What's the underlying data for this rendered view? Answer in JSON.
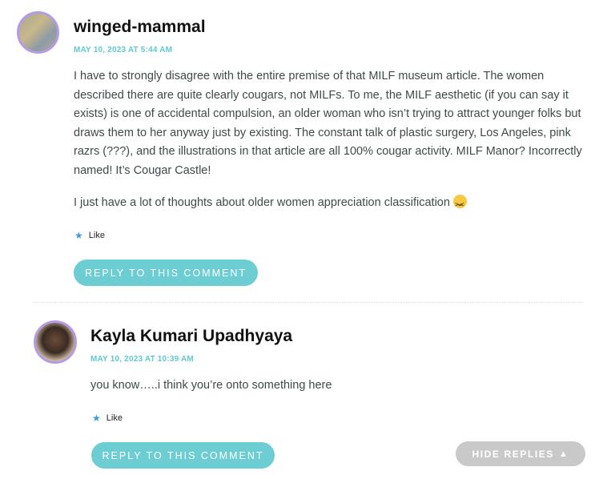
{
  "comments": [
    {
      "author": "winged-mammal",
      "date": "MAY 10, 2023 AT 5:44 AM",
      "paragraphs": [
        "I have to strongly disagree with the entire premise of that MILF museum article. The women described there are quite clearly cougars, not MILFs. To me, the MILF aesthetic (if you can say it exists) is one of accidental compulsion, an older woman who isn’t trying to attract younger folks but draws them to her anyway just by existing. The constant talk of plastic surgery, Los Angeles, pink razrs (???), and the illustrations in that article are all 100% cougar activity. MILF Manor? Incorrectly named! It’s Cougar Castle!",
        "I just have a lot of thoughts about older women appreciation classification"
      ],
      "like_label": "Like",
      "reply_label": "REPLY TO THIS COMMENT"
    },
    {
      "author": "Kayla Kumari Upadhyaya",
      "date": "MAY 10, 2023 AT 10:39 AM",
      "paragraphs": [
        "you know…..i think you’re onto something here"
      ],
      "like_label": "Like",
      "reply_label": "REPLY TO THIS COMMENT"
    }
  ],
  "hide_replies_label": "HIDE REPLIES",
  "icons": {
    "like": "star-icon",
    "emoji": "laughing-squint-emoji-icon",
    "hide": "triangle-up-icon"
  },
  "colors": {
    "accent": "#6ccdd2",
    "date": "#5ecad0",
    "avatar_border": "#b49be6",
    "hide_button": "#c9c9c9"
  }
}
